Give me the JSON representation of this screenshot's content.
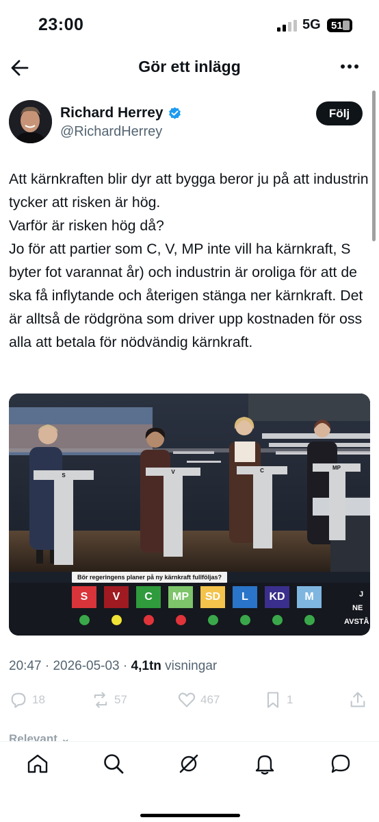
{
  "status_bar": {
    "time": "23:00",
    "network": "5G",
    "battery": "51"
  },
  "header": {
    "title": "Gör ett inlägg",
    "back_icon": "arrow-left-icon",
    "more_icon": "more-horizontal-icon"
  },
  "author": {
    "name": "Richard Herrey",
    "handle": "@RichardHerrey",
    "verified": true,
    "follow_label": "Följ"
  },
  "tweet": {
    "text": "Att kärnkraften blir dyr att bygga beror ju på att industrin tycker att risken är hög.\nVarför är risken hög då?\nJo för att partier som C, V, MP inte vill ha kärnkraft, S byter fot varannat år) och industrin är oroliga för att de ska få inflytande och återigen stänga ner kärnkraft. Det är alltså de rödgröna som driver upp kostnaden för oss alla att betala för nödvändig kärnkraft."
  },
  "media": {
    "question": "Bör regeringens planer på ny kärnkraft fullföljas?",
    "podium_labels": [
      "S",
      "V",
      "C",
      "MP"
    ],
    "parties": [
      {
        "label": "S",
        "color": "#d8343a",
        "vote": "#3aa84a"
      },
      {
        "label": "V",
        "color": "#a01a22",
        "vote": "#f1e335"
      },
      {
        "label": "C",
        "color": "#2f9b3c",
        "vote": "#e0343a"
      },
      {
        "label": "MP",
        "color": "#7dc46a",
        "vote": "#e0343a"
      },
      {
        "label": "SD",
        "color": "#f3c34c",
        "vote": "#3aa84a"
      },
      {
        "label": "L",
        "color": "#2a74c9",
        "vote": "#3aa84a"
      },
      {
        "label": "KD",
        "color": "#3a2f8c",
        "vote": "#3aa84a"
      },
      {
        "label": "M",
        "color": "#7fb6e0",
        "vote": "#3aa84a"
      }
    ],
    "side_text": [
      "J",
      "NE",
      "AVSTÅ"
    ]
  },
  "meta": {
    "time": "20:47",
    "date": "2026-05-03",
    "views_count": "4,1tn",
    "views_label": "visningar"
  },
  "actions": {
    "replies": "18",
    "reposts": "57",
    "likes": "467",
    "bookmarks": "1"
  },
  "sort_label": "Relevant",
  "bottom_nav": [
    "home-icon",
    "search-icon",
    "grok-icon",
    "notifications-icon",
    "messages-icon"
  ]
}
